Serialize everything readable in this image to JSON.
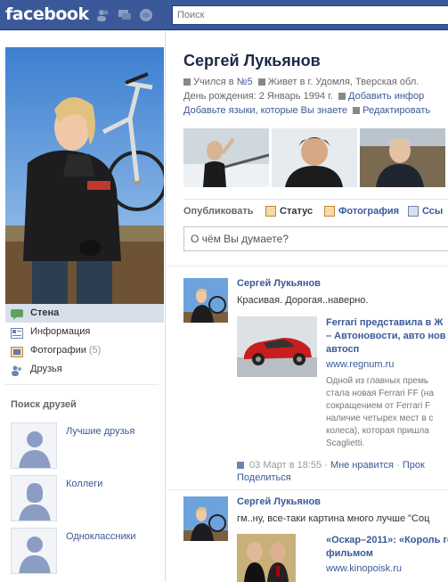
{
  "header": {
    "logo": "facebook",
    "search_placeholder": "Поиск",
    "jewels": [
      "friends-icon",
      "messages-icon",
      "notifications-icon"
    ]
  },
  "profile": {
    "name": "Сергей Лукьянов",
    "studied_prefix": "Учился в ",
    "studied_link": "№5",
    "lives_text": "Живет в г. Удомля, Тверская обл.",
    "birthday": "День рождения: 2 Январь 1994 г.",
    "add_info": "Добавить инфор",
    "add_languages": "Добавьте языки, которые Вы знаете",
    "edit": "Редактировать"
  },
  "nav": {
    "items": [
      {
        "label": "Стена",
        "icon": "wall-icon",
        "selected": true
      },
      {
        "label": "Информация",
        "icon": "info-icon",
        "selected": false
      },
      {
        "label": "Фотографии",
        "count": "(5)",
        "icon": "photos-icon",
        "selected": false
      },
      {
        "label": "Друзья",
        "icon": "friends-icon",
        "selected": false
      }
    ]
  },
  "friend_search": {
    "title": "Поиск друзей",
    "groups": [
      {
        "label": "Лучшие друзья"
      },
      {
        "label": "Коллеги"
      },
      {
        "label": "Одноклассники"
      }
    ]
  },
  "publisher": {
    "label": "Опубликовать",
    "tabs": [
      "Статус",
      "Фотография",
      "Ссы"
    ],
    "placeholder": "О чём Вы думаете?"
  },
  "stories": [
    {
      "author": "Сергей Лукьянов",
      "message": "Красивая. Дорогая..наверно.",
      "attachment_title": [
        "Ferrari представила в Ж",
        "– Автоновости, авто нов",
        "автосп"
      ],
      "attachment_url": "www.regnum.ru",
      "attachment_desc": [
        "Одной из главных премь",
        "стала новая Ferrari FF (на",
        "сокращением от Ferrari F",
        "наличие четырех мест в с",
        "колеса), которая пришла",
        "Scaglietti."
      ],
      "time": "03 Март в 18:55",
      "like": "Мне нравится",
      "more": "Прок",
      "share": "Поделиться"
    },
    {
      "author": "Сергей Лукьянов",
      "message": "гм..ну, все-таки картина много лучше \"Соц",
      "attachment_title": [
        "«Оскар–2011»: «Король гово",
        "фильмом"
      ],
      "attachment_url": "www.kinopoisk.ru"
    }
  ],
  "colors": {
    "brand": "#3b5998",
    "nav_selected": "#d8dfea",
    "link": "#3b5998"
  }
}
